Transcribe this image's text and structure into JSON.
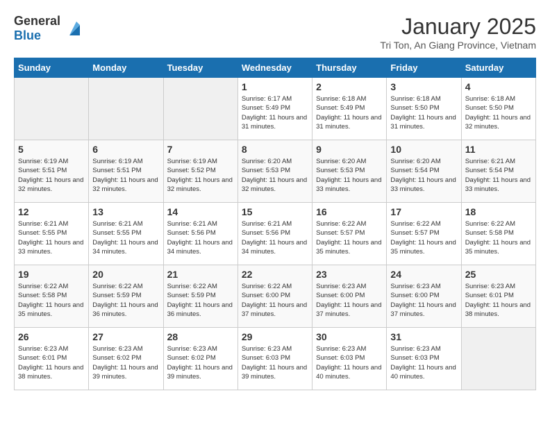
{
  "header": {
    "logo_general": "General",
    "logo_blue": "Blue",
    "month": "January 2025",
    "location": "Tri Ton, An Giang Province, Vietnam"
  },
  "days_of_week": [
    "Sunday",
    "Monday",
    "Tuesday",
    "Wednesday",
    "Thursday",
    "Friday",
    "Saturday"
  ],
  "weeks": [
    [
      {
        "day": "",
        "empty": true
      },
      {
        "day": "",
        "empty": true
      },
      {
        "day": "",
        "empty": true
      },
      {
        "day": "1",
        "sunrise": "6:17 AM",
        "sunset": "5:49 PM",
        "daylight": "11 hours and 31 minutes."
      },
      {
        "day": "2",
        "sunrise": "6:18 AM",
        "sunset": "5:49 PM",
        "daylight": "11 hours and 31 minutes."
      },
      {
        "day": "3",
        "sunrise": "6:18 AM",
        "sunset": "5:50 PM",
        "daylight": "11 hours and 31 minutes."
      },
      {
        "day": "4",
        "sunrise": "6:18 AM",
        "sunset": "5:50 PM",
        "daylight": "11 hours and 32 minutes."
      }
    ],
    [
      {
        "day": "5",
        "sunrise": "6:19 AM",
        "sunset": "5:51 PM",
        "daylight": "11 hours and 32 minutes."
      },
      {
        "day": "6",
        "sunrise": "6:19 AM",
        "sunset": "5:51 PM",
        "daylight": "11 hours and 32 minutes."
      },
      {
        "day": "7",
        "sunrise": "6:19 AM",
        "sunset": "5:52 PM",
        "daylight": "11 hours and 32 minutes."
      },
      {
        "day": "8",
        "sunrise": "6:20 AM",
        "sunset": "5:53 PM",
        "daylight": "11 hours and 32 minutes."
      },
      {
        "day": "9",
        "sunrise": "6:20 AM",
        "sunset": "5:53 PM",
        "daylight": "11 hours and 33 minutes."
      },
      {
        "day": "10",
        "sunrise": "6:20 AM",
        "sunset": "5:54 PM",
        "daylight": "11 hours and 33 minutes."
      },
      {
        "day": "11",
        "sunrise": "6:21 AM",
        "sunset": "5:54 PM",
        "daylight": "11 hours and 33 minutes."
      }
    ],
    [
      {
        "day": "12",
        "sunrise": "6:21 AM",
        "sunset": "5:55 PM",
        "daylight": "11 hours and 33 minutes."
      },
      {
        "day": "13",
        "sunrise": "6:21 AM",
        "sunset": "5:55 PM",
        "daylight": "11 hours and 34 minutes."
      },
      {
        "day": "14",
        "sunrise": "6:21 AM",
        "sunset": "5:56 PM",
        "daylight": "11 hours and 34 minutes."
      },
      {
        "day": "15",
        "sunrise": "6:21 AM",
        "sunset": "5:56 PM",
        "daylight": "11 hours and 34 minutes."
      },
      {
        "day": "16",
        "sunrise": "6:22 AM",
        "sunset": "5:57 PM",
        "daylight": "11 hours and 35 minutes."
      },
      {
        "day": "17",
        "sunrise": "6:22 AM",
        "sunset": "5:57 PM",
        "daylight": "11 hours and 35 minutes."
      },
      {
        "day": "18",
        "sunrise": "6:22 AM",
        "sunset": "5:58 PM",
        "daylight": "11 hours and 35 minutes."
      }
    ],
    [
      {
        "day": "19",
        "sunrise": "6:22 AM",
        "sunset": "5:58 PM",
        "daylight": "11 hours and 35 minutes."
      },
      {
        "day": "20",
        "sunrise": "6:22 AM",
        "sunset": "5:59 PM",
        "daylight": "11 hours and 36 minutes."
      },
      {
        "day": "21",
        "sunrise": "6:22 AM",
        "sunset": "5:59 PM",
        "daylight": "11 hours and 36 minutes."
      },
      {
        "day": "22",
        "sunrise": "6:22 AM",
        "sunset": "6:00 PM",
        "daylight": "11 hours and 37 minutes."
      },
      {
        "day": "23",
        "sunrise": "6:23 AM",
        "sunset": "6:00 PM",
        "daylight": "11 hours and 37 minutes."
      },
      {
        "day": "24",
        "sunrise": "6:23 AM",
        "sunset": "6:00 PM",
        "daylight": "11 hours and 37 minutes."
      },
      {
        "day": "25",
        "sunrise": "6:23 AM",
        "sunset": "6:01 PM",
        "daylight": "11 hours and 38 minutes."
      }
    ],
    [
      {
        "day": "26",
        "sunrise": "6:23 AM",
        "sunset": "6:01 PM",
        "daylight": "11 hours and 38 minutes."
      },
      {
        "day": "27",
        "sunrise": "6:23 AM",
        "sunset": "6:02 PM",
        "daylight": "11 hours and 39 minutes."
      },
      {
        "day": "28",
        "sunrise": "6:23 AM",
        "sunset": "6:02 PM",
        "daylight": "11 hours and 39 minutes."
      },
      {
        "day": "29",
        "sunrise": "6:23 AM",
        "sunset": "6:03 PM",
        "daylight": "11 hours and 39 minutes."
      },
      {
        "day": "30",
        "sunrise": "6:23 AM",
        "sunset": "6:03 PM",
        "daylight": "11 hours and 40 minutes."
      },
      {
        "day": "31",
        "sunrise": "6:23 AM",
        "sunset": "6:03 PM",
        "daylight": "11 hours and 40 minutes."
      },
      {
        "day": "",
        "empty": true
      }
    ]
  ]
}
